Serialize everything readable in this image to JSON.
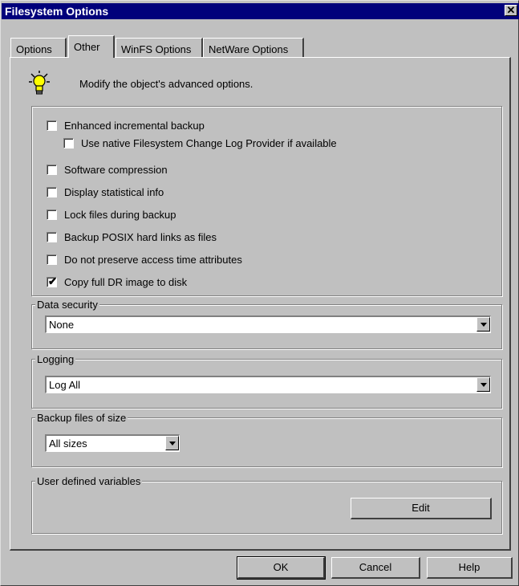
{
  "window": {
    "title": "Filesystem Options",
    "close_label": "✕"
  },
  "tabs": [
    {
      "label": "Options"
    },
    {
      "label": "Other"
    },
    {
      "label": "WinFS Options"
    },
    {
      "label": "NetWare Options"
    }
  ],
  "header": {
    "description": "Modify the object's advanced options.",
    "icon": "lightbulb-icon"
  },
  "options": [
    {
      "label": "Enhanced incremental backup",
      "checked": false
    },
    {
      "label": "Use native Filesystem Change Log Provider if available",
      "checked": false
    },
    {
      "label": "Software compression",
      "checked": false
    },
    {
      "label": "Display statistical info",
      "checked": false
    },
    {
      "label": "Lock files during backup",
      "checked": false
    },
    {
      "label": "Backup POSIX hard links as files",
      "checked": false
    },
    {
      "label": "Do not preserve access time attributes",
      "checked": false
    },
    {
      "label": "Copy full DR image to disk",
      "checked": true,
      "mark": "✔"
    }
  ],
  "data_security": {
    "label": "Data security",
    "value": "None"
  },
  "logging": {
    "label": "Logging",
    "value": "Log All"
  },
  "backup_size": {
    "label": "Backup files of size",
    "value": "All sizes"
  },
  "user_vars": {
    "label": "User defined variables",
    "edit_label": "Edit"
  },
  "footer": {
    "ok_label": "OK",
    "cancel_label": "Cancel",
    "help_label": "Help"
  }
}
